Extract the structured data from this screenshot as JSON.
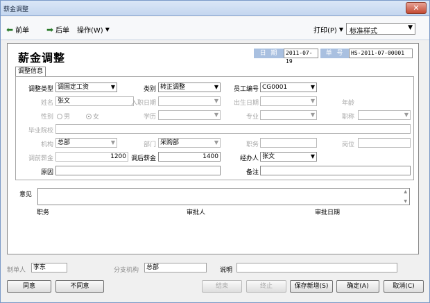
{
  "window": {
    "title": "薪金调整",
    "close": "✕"
  },
  "toolbar": {
    "prev": "前单",
    "next": "后单",
    "operate": "操作(W)",
    "print": "打印(P)",
    "style_value": "标准样式"
  },
  "header": {
    "title": "薪金调整",
    "date_label": "日 期",
    "date_value": "2011-07-19",
    "no_label": "单 号",
    "no_value": "HS-2011-07-00001"
  },
  "tab": {
    "label": "调整信息"
  },
  "form": {
    "adjust_type_label": "调整类型",
    "adjust_type_value": "调固定工资",
    "category_label": "类别",
    "category_value": "转正调整",
    "emp_no_label": "员工编号",
    "emp_no_value": "CG0001",
    "name_label": "姓名",
    "name_value": "张文",
    "join_date_label": "入职日期",
    "birth_label": "出生日期",
    "age_label": "年龄",
    "gender_label": "性别",
    "gender_male": "男",
    "gender_female": "女",
    "education_label": "学历",
    "major_label": "专业",
    "title_label": "职称",
    "school_label": "毕业院校",
    "org_label": "机构",
    "org_value": "总部",
    "dept_label": "部门",
    "dept_value": "采购部",
    "duty_label": "职务",
    "post_label": "岗位",
    "before_label": "调前薪金",
    "before_value": "1200",
    "after_label": "调后薪金",
    "after_value": "1400",
    "handler_label": "经办人",
    "handler_value": "张文",
    "reason_label": "原因",
    "remark_label": "备注"
  },
  "approval": {
    "opinion_label": "意见",
    "col_duty": "职务",
    "col_approver": "审批人",
    "col_date": "审批日期"
  },
  "footer": {
    "maker_label": "制单人",
    "maker_value": "李东",
    "branch_label": "分支机构",
    "branch_value": "总部",
    "note_label": "说明"
  },
  "buttons": {
    "agree": "同意",
    "disagree": "不同意",
    "finish": "结束",
    "stop": "终止",
    "save_new": "保存新增(S)",
    "confirm": "确定(A)",
    "cancel": "取消(C)"
  }
}
